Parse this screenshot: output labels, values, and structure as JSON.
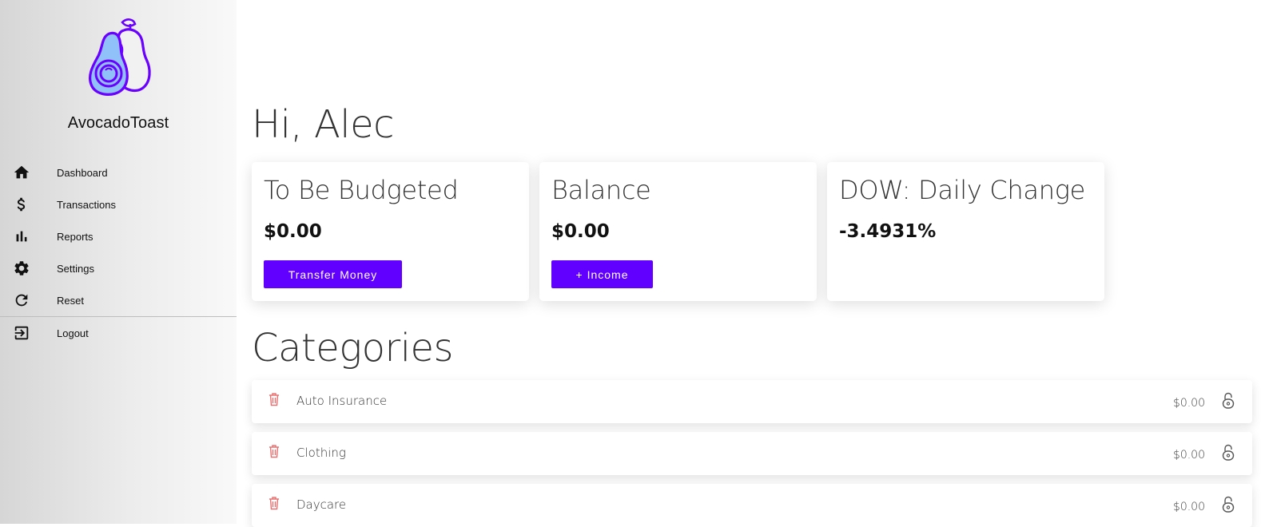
{
  "app": {
    "name": "AvocadoToast",
    "logo_icon": "avocado-icon"
  },
  "colors": {
    "accent": "#6200ff",
    "trash": "#e57373",
    "logo_stroke": "#6a00ff",
    "logo_fill": "#90c2f9"
  },
  "sidebar": {
    "items": [
      {
        "label": "Dashboard",
        "icon": "home-icon"
      },
      {
        "label": "Transactions",
        "icon": "dollar-icon"
      },
      {
        "label": "Reports",
        "icon": "bar-chart-icon"
      },
      {
        "label": "Settings",
        "icon": "gear-icon"
      },
      {
        "label": "Reset",
        "icon": "refresh-icon"
      },
      {
        "label": "Logout",
        "icon": "logout-icon"
      }
    ]
  },
  "main": {
    "greeting": "Hi, Alec",
    "cards": [
      {
        "title": "To Be Budgeted",
        "value": "$0.00",
        "button": "Transfer Money"
      },
      {
        "title": "Balance",
        "value": "$0.00",
        "button": "+ Income"
      },
      {
        "title": "DOW: Daily Change",
        "value": "-3.4931%"
      }
    ],
    "categories_title": "Categories",
    "categories": [
      {
        "name": "Auto Insurance",
        "amount": "$0.00"
      },
      {
        "name": "Clothing",
        "amount": "$0.00"
      },
      {
        "name": "Daycare",
        "amount": "$0.00"
      }
    ]
  }
}
